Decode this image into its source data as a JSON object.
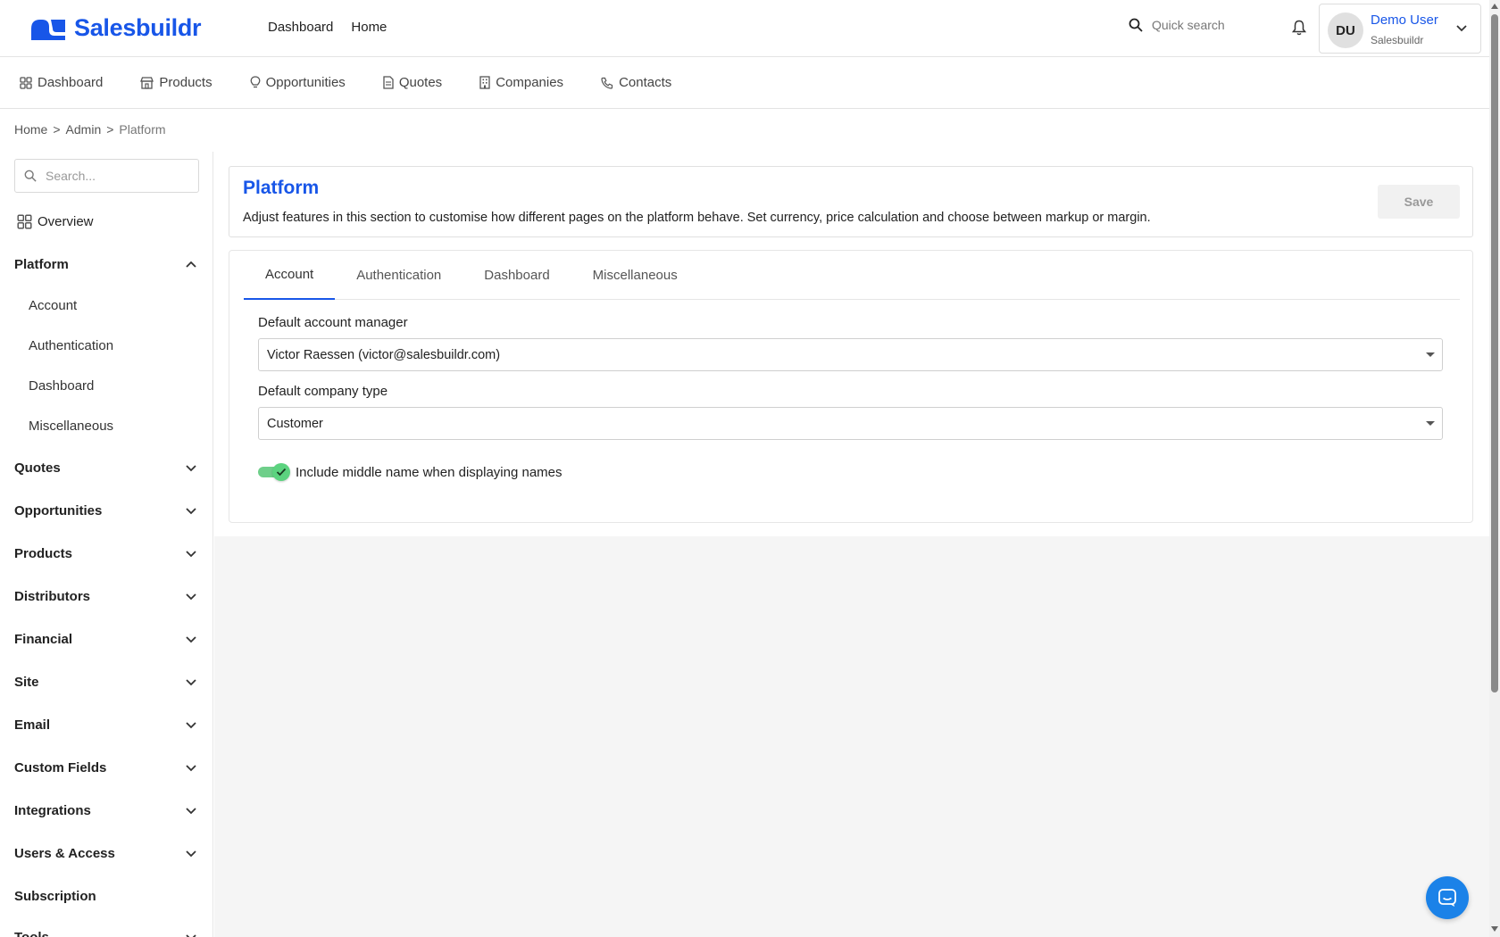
{
  "brand": {
    "name": "Salesbuildr",
    "color": "#1856e8"
  },
  "topnav": {
    "items": [
      "Dashboard",
      "Home"
    ]
  },
  "search": {
    "placeholder": "Quick search"
  },
  "user": {
    "initials": "DU",
    "name": "Demo User",
    "org": "Salesbuildr"
  },
  "subnav": {
    "items": [
      {
        "label": "Dashboard",
        "icon": "dashboard-grid-icon"
      },
      {
        "label": "Products",
        "icon": "store-icon"
      },
      {
        "label": "Opportunities",
        "icon": "lightbulb-icon"
      },
      {
        "label": "Quotes",
        "icon": "document-icon"
      },
      {
        "label": "Companies",
        "icon": "building-icon"
      },
      {
        "label": "Contacts",
        "icon": "phone-icon"
      }
    ]
  },
  "breadcrumb": {
    "items": [
      "Home",
      "Admin",
      "Platform"
    ],
    "separator": ">"
  },
  "sidebar": {
    "search_placeholder": "Search...",
    "overview": "Overview",
    "platform": {
      "label": "Platform",
      "children": [
        "Account",
        "Authentication",
        "Dashboard",
        "Miscellaneous"
      ]
    },
    "groups": [
      "Quotes",
      "Opportunities",
      "Products",
      "Distributors",
      "Financial",
      "Site",
      "Email",
      "Custom Fields",
      "Integrations",
      "Users & Access",
      "Subscription",
      "Tools"
    ]
  },
  "page": {
    "title": "Platform",
    "description": "Adjust features in this section to customise how different pages on the platform behave. Set currency, price calculation and choose between markup or margin.",
    "save_label": "Save"
  },
  "tabs": {
    "items": [
      "Account",
      "Authentication",
      "Dashboard",
      "Miscellaneous"
    ],
    "active": "Account"
  },
  "form": {
    "account_manager_label": "Default account manager",
    "account_manager_value": "Victor Raessen (victor@salesbuildr.com)",
    "company_type_label": "Default company type",
    "company_type_value": "Customer",
    "middle_name_label": "Include middle name when displaying names",
    "middle_name_enabled": true
  },
  "colors": {
    "accent": "#1856e8",
    "toggle_on": "#5cd37f",
    "chat": "#1b82e8"
  }
}
